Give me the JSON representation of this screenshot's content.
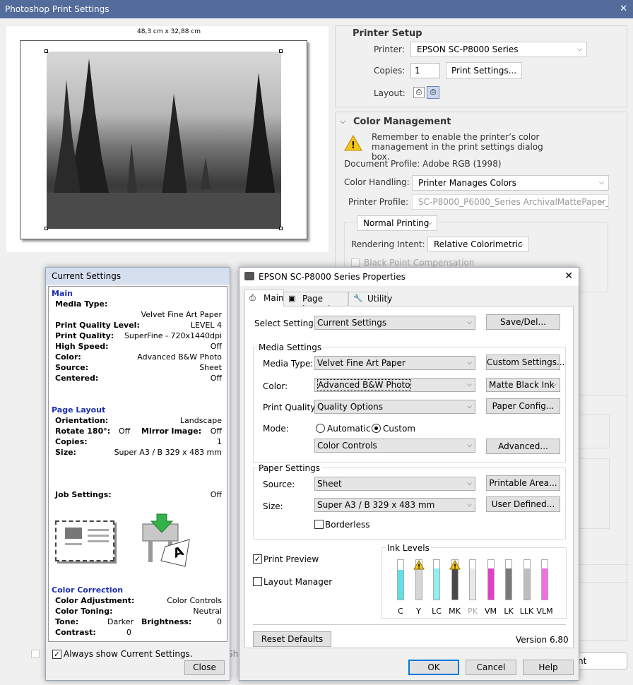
{
  "ps": {
    "title": "Photoshop Print Settings",
    "close_glyph": "✕",
    "paper_size": "48,3 cm x 32,88 cm",
    "printer_setup": {
      "heading": "Printer Setup",
      "printer_label": "Printer:",
      "printer_value": "EPSON SC-P8000 Series",
      "copies_label": "Copies:",
      "copies_value": "1",
      "print_settings_btn": "Print Settings...",
      "layout_label": "Layout:"
    },
    "color_mgmt": {
      "heading": "Color Management",
      "warning": "Remember to enable the printer’s color management in the print settings dialog box.",
      "doc_profile": "Document Profile: Adobe RGB (1998)",
      "handling_label": "Color Handling:",
      "handling_value": "Printer Manages Colors",
      "profile_label": "Printer Profile:",
      "profile_value": "SC-P8000_P6000_Series ArchivalMattePaper_...",
      "mode_value": "Normal Printing",
      "intent_label": "Rendering Intent:",
      "intent_value": "Relative Colorimetric",
      "bpc_label": "Black Point Compensation"
    },
    "bottom_partial": "Sho",
    "print_partial": "nt"
  },
  "cs": {
    "title": "Current Settings",
    "main_h": "Main",
    "media_type_k": "Media Type:",
    "media_type_v": "Velvet Fine Art Paper",
    "rows1": [
      {
        "k": "Print Quality Level:",
        "v": "LEVEL 4"
      },
      {
        "k": "Print Quality:",
        "v": "SuperFine - 720x1440dpi"
      },
      {
        "k": "High Speed:",
        "v": "Off"
      },
      {
        "k": "Color:",
        "v": "Advanced B&W Photo"
      },
      {
        "k": "Source:",
        "v": "Sheet"
      },
      {
        "k": "Centered:",
        "v": "Off"
      }
    ],
    "layout_h": "Page Layout",
    "orientation_k": "Orientation:",
    "orientation_v": "Landscape",
    "rotate_k": "Rotate 180°:",
    "rotate_v": "Off",
    "mirror_k": "Mirror Image:",
    "mirror_v": "Off",
    "copies_k": "Copies:",
    "copies_v": "1",
    "size_k": "Size:",
    "size_v": "Super A3 / B 329 x 483 mm",
    "job_k": "Job Settings:",
    "job_v": "Off",
    "cc_h": "Color Correction",
    "adj_k": "Color Adjustment:",
    "adj_v": "Color Controls",
    "toning_k": "Color Toning:",
    "toning_v": "Neutral",
    "tone_k": "Tone:",
    "tone_v": "Darker",
    "bright_k": "Brightness:",
    "bright_v": "0",
    "contrast_k": "Contrast:",
    "contrast_v": "0",
    "always_show": "Always show Current Settings.",
    "close_btn": "Close"
  },
  "ep": {
    "title": "EPSON SC-P8000 Series Properties",
    "close_glyph": "✕",
    "tabs": [
      "Main",
      "Page Layout",
      "Utility"
    ],
    "select_label": "Select Setting:",
    "select_value": "Current Settings",
    "savedel_btn": "Save/Del...",
    "media_group": "Media Settings",
    "media_type_label": "Media Type:",
    "media_type_value": "Velvet Fine Art Paper",
    "custom_btn": "Custom Settings...",
    "color_label": "Color:",
    "color_value": "Advanced B&W Photo",
    "ink_value": "Matte Black Ink",
    "pq_label": "Print Quality:",
    "pq_value": "Quality Options",
    "paperconfig_btn": "Paper Config...",
    "mode_label": "Mode:",
    "mode_auto": "Automatic",
    "mode_custom": "Custom",
    "cc_value": "Color Controls",
    "advanced_btn": "Advanced...",
    "paper_group": "Paper Settings",
    "source_label": "Source:",
    "source_value": "Sheet",
    "printable_btn": "Printable Area...",
    "size_label": "Size:",
    "size_value": "Super A3 / B 329 x 483 mm",
    "userdef_btn": "User Defined...",
    "borderless": "Borderless",
    "print_preview": "Print Preview",
    "layout_manager": "Layout Manager",
    "ink_group": "Ink Levels",
    "inks": [
      {
        "name": "C",
        "level": 0.75,
        "color": "#5ee0e6",
        "warn": false
      },
      {
        "name": "Y",
        "level": 0.78,
        "color": "#d6d6d6",
        "warn": true
      },
      {
        "name": "LC",
        "level": 0.78,
        "color": "#8ff0f4",
        "warn": false
      },
      {
        "name": "MK",
        "level": 0.78,
        "color": "#4a4a4a",
        "warn": true
      },
      {
        "name": "PK",
        "level": 0.78,
        "color": "#e8e8e8",
        "warn": false
      },
      {
        "name": "VM",
        "level": 0.78,
        "color": "#e040c8",
        "warn": false
      },
      {
        "name": "LK",
        "level": 0.78,
        "color": "#7a7a7a",
        "warn": false
      },
      {
        "name": "LLK",
        "level": 0.78,
        "color": "#bdbdbd",
        "warn": false
      },
      {
        "name": "VLM",
        "level": 0.78,
        "color": "#f070e0",
        "warn": false
      }
    ],
    "reset_btn": "Reset Defaults",
    "version": "Version 6.80",
    "ok_btn": "OK",
    "cancel_btn": "Cancel",
    "help_btn": "Help"
  }
}
